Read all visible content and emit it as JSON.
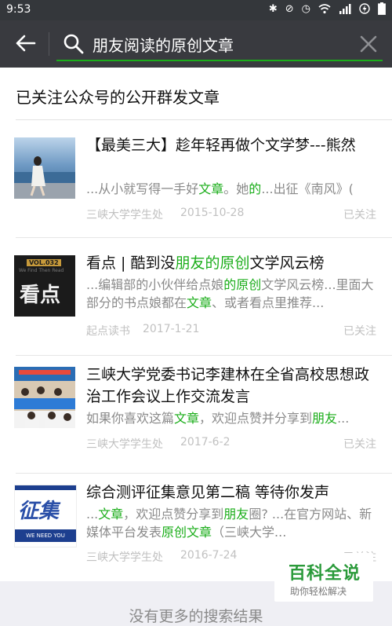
{
  "status": {
    "time": "9:53"
  },
  "search": {
    "query": "朋友阅读的原创文章"
  },
  "section": {
    "title": "已关注公众号的公开群发文章"
  },
  "articles": [
    {
      "title": "【最美三大】趁年轻再做个文学梦---熊然",
      "snippet": [
        {
          "t": "...从小就写得一手好",
          "h": false
        },
        {
          "t": "文章",
          "h": true
        },
        {
          "t": "。她",
          "h": false
        },
        {
          "t": "的",
          "h": true
        },
        {
          "t": "...出征《南风》(",
          "h": false
        }
      ],
      "source": "三峡大学学生处",
      "date": "2015-10-28",
      "status": "已关注"
    },
    {
      "title_parts": [
        {
          "t": "看点 | 酷到没",
          "h": false
        },
        {
          "t": "朋友的原创",
          "h": true
        },
        {
          "t": "文学风云榜",
          "h": false
        }
      ],
      "snippet": [
        {
          "t": "...编辑部的小伙伴给点娘",
          "h": false
        },
        {
          "t": "的原创",
          "h": true
        },
        {
          "t": "文学风云榜...里面大部分的书点娘都在",
          "h": false
        },
        {
          "t": "文章",
          "h": true
        },
        {
          "t": "、或者看点里推荐...",
          "h": false
        }
      ],
      "source": "起点读书",
      "date": "2017-1-21",
      "status": "已关注",
      "thumb_text": "看点",
      "thumb_tag": "VOL.032",
      "thumb_sub": "We Find Then Read"
    },
    {
      "title": "三峡大学党委书记李建林在全省高校思想政治工作会议上作交流发言",
      "snippet": [
        {
          "t": "如果你喜欢这篇",
          "h": false
        },
        {
          "t": "文章",
          "h": true
        },
        {
          "t": "，欢迎点赞并分享到",
          "h": false
        },
        {
          "t": "朋友",
          "h": true
        },
        {
          "t": "...",
          "h": false
        }
      ],
      "source": "三峡大学学生处",
      "date": "2017-6-2",
      "status": "已关注"
    },
    {
      "title": "综合测评征集意见第二稿 等待你发声",
      "snippet": [
        {
          "t": "...",
          "h": false
        },
        {
          "t": "文章",
          "h": true
        },
        {
          "t": "，欢迎点赞分享到",
          "h": false
        },
        {
          "t": "朋友",
          "h": true
        },
        {
          "t": "圈? ...在官方网站、新媒体平台发表",
          "h": false
        },
        {
          "t": "原创文章",
          "h": true
        },
        {
          "t": "（三峡大学...",
          "h": false
        }
      ],
      "source": "三峡大学学生处",
      "date": "2016-7-24",
      "status": "已关注",
      "thumb_text": "征集",
      "thumb_sub": "WE NEED YOU"
    }
  ],
  "footer": {
    "no_more": "没有更多的搜索结果"
  },
  "watermark": {
    "title": "百科全说",
    "subtitle": "助你轻松解决"
  },
  "colors": {
    "accent": "#1aad19",
    "topbar": "#393a3f"
  }
}
